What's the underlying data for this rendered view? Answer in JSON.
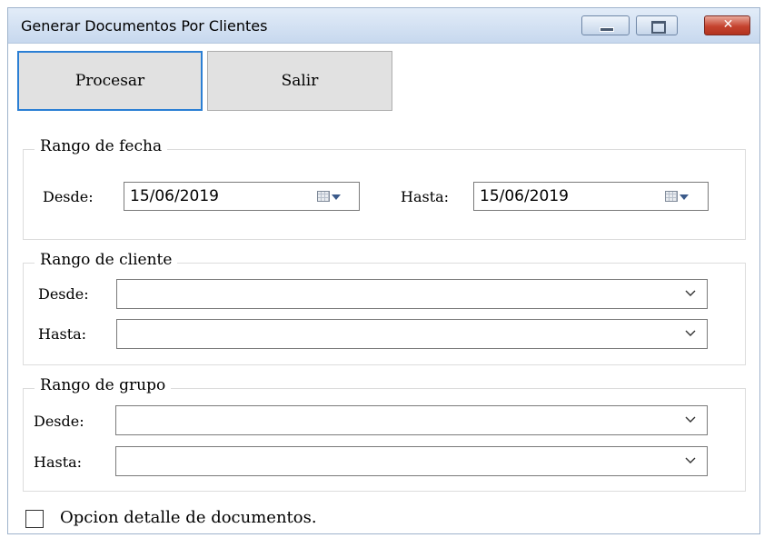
{
  "window": {
    "title": "Generar Documentos Por Clientes"
  },
  "toolbar": {
    "procesar_label": "Procesar",
    "salir_label": "Salir"
  },
  "fecha": {
    "legend": "Rango de fecha",
    "desde_label": "Desde:",
    "desde_value": "15/06/2019",
    "hasta_label": "Hasta:",
    "hasta_value": "15/06/2019"
  },
  "cliente": {
    "legend": "Rango de cliente",
    "desde_label": "Desde:",
    "desde_value": "",
    "hasta_label": "Hasta:",
    "hasta_value": ""
  },
  "grupo": {
    "legend": "Rango de grupo",
    "desde_label": "Desde:",
    "desde_value": "",
    "hasta_label": "Hasta:",
    "hasta_value": ""
  },
  "detalle": {
    "label": "Opcion detalle de documentos.",
    "checked": false
  },
  "icons": {
    "minimize": "minimize-icon",
    "maximize": "maximize-icon",
    "close": "close-icon",
    "calendar": "calendar-icon",
    "dropdown": "chevron-down-icon"
  },
  "colors": {
    "focus_border": "#2b7fd4",
    "close_button": "#c5432f"
  }
}
